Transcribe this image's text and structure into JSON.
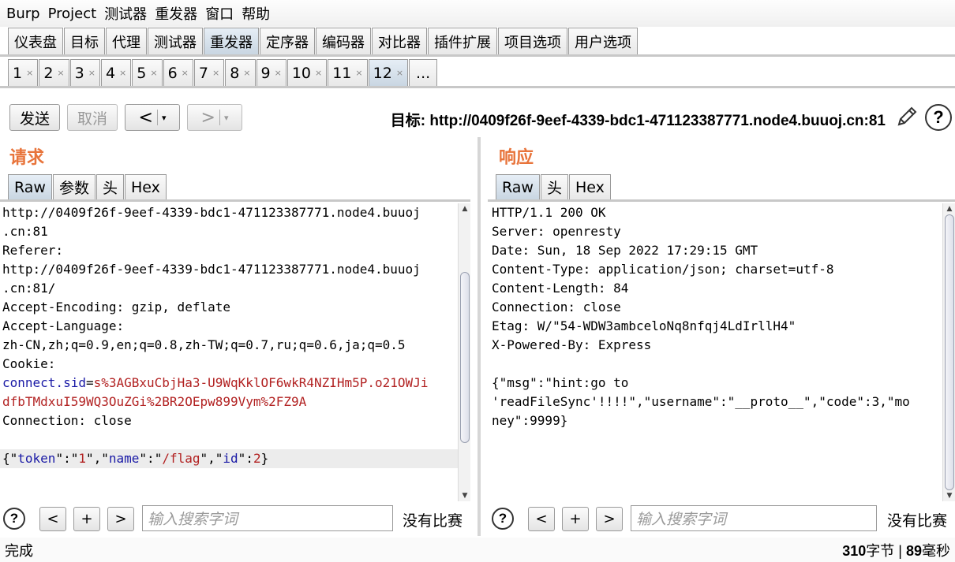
{
  "menubar": [
    "Burp",
    "Project",
    "测试器",
    "重发器",
    "窗口",
    "帮助"
  ],
  "main_tabs": [
    {
      "label": "仪表盘",
      "active": false
    },
    {
      "label": "目标",
      "active": false
    },
    {
      "label": "代理",
      "active": false
    },
    {
      "label": "测试器",
      "active": false
    },
    {
      "label": "重发器",
      "active": true
    },
    {
      "label": "定序器",
      "active": false
    },
    {
      "label": "编码器",
      "active": false
    },
    {
      "label": "对比器",
      "active": false
    },
    {
      "label": "插件扩展",
      "active": false
    },
    {
      "label": "项目选项",
      "active": false
    },
    {
      "label": "用户选项",
      "active": false
    }
  ],
  "repeater_tabs": [
    {
      "label": "1",
      "close": "×",
      "active": false
    },
    {
      "label": "2",
      "close": "×",
      "active": false
    },
    {
      "label": "3",
      "close": "×",
      "active": false
    },
    {
      "label": "4",
      "close": "×",
      "active": false
    },
    {
      "label": "5",
      "close": "×",
      "active": false
    },
    {
      "label": "6",
      "close": "×",
      "active": false
    },
    {
      "label": "7",
      "close": "×",
      "active": false
    },
    {
      "label": "8",
      "close": "×",
      "active": false
    },
    {
      "label": "9",
      "close": "×",
      "active": false
    },
    {
      "label": "10",
      "close": "×",
      "active": false
    },
    {
      "label": "11",
      "close": "×",
      "active": false
    },
    {
      "label": "12",
      "close": "×",
      "active": true
    }
  ],
  "repeater_more": "...",
  "toolbar": {
    "send": "发送",
    "cancel": "取消",
    "back": "<",
    "forward": ">",
    "dropdown": "▾",
    "target_label": "目标:",
    "target_url": "http://0409f26f-9eef-4339-bdc1-471123387771.node4.buuoj.cn:81",
    "edit_icon": "pencil-icon",
    "help_icon": "help-icon",
    "help_glyph": "?"
  },
  "request": {
    "title": "请求",
    "tabs": [
      {
        "label": "Raw",
        "active": true
      },
      {
        "label": "参数",
        "active": false
      },
      {
        "label": "头",
        "active": false
      },
      {
        "label": "Hex",
        "active": false
      }
    ],
    "lines": [
      {
        "text": "http://0409f26f-9eef-4339-bdc1-471123387771.node4.buuoj"
      },
      {
        "text": ".cn:81"
      },
      {
        "text": "Referer:"
      },
      {
        "text": "http://0409f26f-9eef-4339-bdc1-471123387771.node4.buuoj"
      },
      {
        "text": ".cn:81/"
      },
      {
        "text": "Accept-Encoding: gzip, deflate"
      },
      {
        "text": "Accept-Language:"
      },
      {
        "text": "zh-CN,zh;q=0.9,en;q=0.8,zh-TW;q=0.7,ru;q=0.6,ja;q=0.5"
      },
      {
        "text": "Cookie:"
      },
      {
        "parts": [
          {
            "t": "connect.sid",
            "c": "blue"
          },
          {
            "t": "=",
            "c": ""
          },
          {
            "t": "s%3AGBxuCbjHa3-U9WqKklOF6wkR4NZIHm5P.o21OWJi",
            "c": "red"
          }
        ]
      },
      {
        "parts": [
          {
            "t": "dfbTMdxuI59WQ3OuZGi%2BR2OEpw899Vym%2FZ9A",
            "c": "red"
          }
        ]
      },
      {
        "text": "Connection: close"
      },
      {
        "text": ""
      },
      {
        "hl": true,
        "parts": [
          {
            "t": "{\"",
            "c": ""
          },
          {
            "t": "token",
            "c": "blue"
          },
          {
            "t": "\":\"",
            "c": ""
          },
          {
            "t": "1",
            "c": "red"
          },
          {
            "t": "\",\"",
            "c": ""
          },
          {
            "t": "name",
            "c": "blue"
          },
          {
            "t": "\":\"",
            "c": ""
          },
          {
            "t": "/flag",
            "c": "red"
          },
          {
            "t": "\",\"",
            "c": ""
          },
          {
            "t": "id",
            "c": "blue"
          },
          {
            "t": "\":",
            "c": ""
          },
          {
            "t": "2",
            "c": "red"
          },
          {
            "t": "}",
            "c": ""
          }
        ]
      }
    ],
    "search": {
      "prev": "<",
      "add": "+",
      "next": ">",
      "placeholder": "输入搜索字词",
      "no_match": "没有比赛"
    }
  },
  "response": {
    "title": "响应",
    "tabs": [
      {
        "label": "Raw",
        "active": true
      },
      {
        "label": "头",
        "active": false
      },
      {
        "label": "Hex",
        "active": false
      }
    ],
    "lines": [
      {
        "text": "HTTP/1.1 200 OK"
      },
      {
        "text": "Server: openresty"
      },
      {
        "text": "Date: Sun, 18 Sep 2022 17:29:15 GMT"
      },
      {
        "text": "Content-Type: application/json; charset=utf-8"
      },
      {
        "text": "Content-Length: 84"
      },
      {
        "text": "Connection: close"
      },
      {
        "text": "Etag: W/\"54-WDW3ambceloNq8nfqj4LdIrllH4\""
      },
      {
        "text": "X-Powered-By: Express"
      },
      {
        "text": ""
      },
      {
        "text": "{\"msg\":\"hint:go to"
      },
      {
        "text": "'readFileSync'!!!!\",\"username\":\"__proto__\",\"code\":3,\"mo"
      },
      {
        "text": "ney\":9999}"
      }
    ],
    "search": {
      "prev": "<",
      "add": "+",
      "next": ">",
      "placeholder": "输入搜索字词",
      "no_match": "没有比赛"
    }
  },
  "status": {
    "left": "完成",
    "bytes": "310",
    "bytes_unit": "字节",
    "separator": "|",
    "ms": "89",
    "ms_unit": "毫秒"
  },
  "request_scroll_fraction": 0.55,
  "response_scroll_fraction": 0.0
}
